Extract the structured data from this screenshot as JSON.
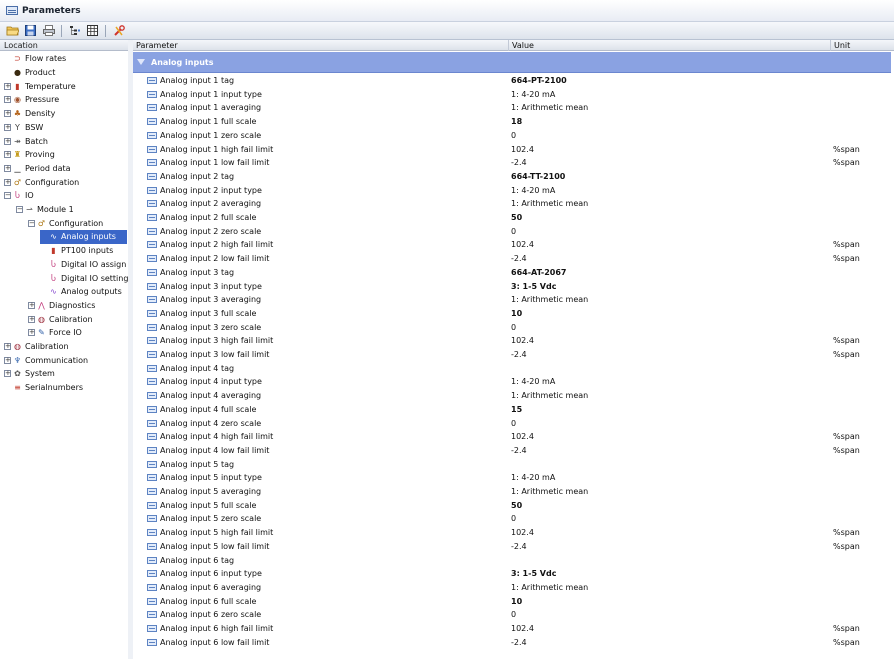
{
  "window": {
    "title": "Parameters"
  },
  "toolbar": {
    "icons": [
      "open-folder-icon",
      "save-icon",
      "print-icon",
      "tree-icon",
      "table-icon",
      "tools-icon"
    ]
  },
  "left_panel": {
    "header": "Location",
    "tree": [
      {
        "label": "Flow rates",
        "icon": "flow-icon",
        "depth": 0,
        "expander": "",
        "selected": false
      },
      {
        "label": "Product",
        "icon": "drop-icon",
        "depth": 0,
        "expander": "",
        "selected": false
      },
      {
        "label": "Temperature",
        "icon": "thermometer-icon",
        "depth": 0,
        "expander": "+",
        "selected": false
      },
      {
        "label": "Pressure",
        "icon": "gauge-icon",
        "depth": 0,
        "expander": "+",
        "selected": false
      },
      {
        "label": "Density",
        "icon": "density-icon",
        "depth": 0,
        "expander": "+",
        "selected": false
      },
      {
        "label": "BSW",
        "icon": "funnel-icon",
        "depth": 0,
        "expander": "+",
        "selected": false
      },
      {
        "label": "Batch",
        "icon": "batch-icon",
        "depth": 0,
        "expander": "+",
        "selected": false
      },
      {
        "label": "Proving",
        "icon": "proving-icon",
        "depth": 0,
        "expander": "+",
        "selected": false
      },
      {
        "label": "Period data",
        "icon": "period-icon",
        "depth": 0,
        "expander": "+",
        "selected": false
      },
      {
        "label": "Configuration",
        "icon": "configuration-icon",
        "depth": 0,
        "expander": "+",
        "selected": false
      },
      {
        "label": "IO",
        "icon": "io-icon",
        "depth": 0,
        "expander": "−",
        "selected": false
      },
      {
        "label": "Module 1",
        "icon": "module-icon",
        "depth": 1,
        "expander": "−",
        "selected": false
      },
      {
        "label": "Configuration",
        "icon": "configuration-icon",
        "depth": 2,
        "expander": "−",
        "selected": false
      },
      {
        "label": "Analog inputs",
        "icon": "analog-wave-icon",
        "depth": 3,
        "expander": "",
        "selected": true
      },
      {
        "label": "PT100 inputs",
        "icon": "thermometer-icon",
        "depth": 3,
        "expander": "",
        "selected": false
      },
      {
        "label": "Digital IO assign",
        "icon": "digital-icon",
        "depth": 3,
        "expander": "",
        "selected": false
      },
      {
        "label": "Digital IO settings",
        "icon": "digital-icon",
        "depth": 3,
        "expander": "",
        "selected": false
      },
      {
        "label": "Analog outputs",
        "icon": "analog-wave-icon",
        "depth": 3,
        "expander": "",
        "selected": false
      },
      {
        "label": "Diagnostics",
        "icon": "diagnostics-icon",
        "depth": 2,
        "expander": "+",
        "selected": false
      },
      {
        "label": "Calibration",
        "icon": "calibration-icon",
        "depth": 2,
        "expander": "+",
        "selected": false
      },
      {
        "label": "Force IO",
        "icon": "wrench-icon",
        "depth": 2,
        "expander": "+",
        "selected": false
      },
      {
        "label": "Calibration",
        "icon": "calibration-icon",
        "depth": 0,
        "expander": "+",
        "selected": false
      },
      {
        "label": "Communication",
        "icon": "network-icon",
        "depth": 0,
        "expander": "+",
        "selected": false
      },
      {
        "label": "System",
        "icon": "gear-icon",
        "depth": 0,
        "expander": "+",
        "selected": false
      },
      {
        "label": "Serialnumbers",
        "icon": "serial-icon",
        "depth": 0,
        "expander": "",
        "selected": false
      }
    ]
  },
  "grid": {
    "columns": {
      "parameter": "Parameter",
      "value": "Value",
      "unit": "Unit"
    },
    "group": "Analog inputs",
    "rows": [
      {
        "param": "Analog input 1 tag",
        "value": "664-PT-2100",
        "bold": true,
        "unit": ""
      },
      {
        "param": "Analog input 1 input type",
        "value": "1: 4-20 mA",
        "bold": false,
        "unit": ""
      },
      {
        "param": "Analog input 1 averaging",
        "value": "1: Arithmetic mean",
        "bold": false,
        "unit": ""
      },
      {
        "param": "Analog input 1 full scale",
        "value": "18",
        "bold": true,
        "unit": ""
      },
      {
        "param": "Analog input 1 zero scale",
        "value": "0",
        "bold": false,
        "unit": ""
      },
      {
        "param": "Analog input 1 high fail limit",
        "value": "102.4",
        "bold": false,
        "unit": "%span"
      },
      {
        "param": "Analog input 1 low fail limit",
        "value": "-2.4",
        "bold": false,
        "unit": "%span"
      },
      {
        "param": "Analog input 2 tag",
        "value": "664-TT-2100",
        "bold": true,
        "unit": ""
      },
      {
        "param": "Analog input 2 input type",
        "value": "1: 4-20 mA",
        "bold": false,
        "unit": ""
      },
      {
        "param": "Analog input 2 averaging",
        "value": "1: Arithmetic mean",
        "bold": false,
        "unit": ""
      },
      {
        "param": "Analog input 2 full scale",
        "value": "50",
        "bold": true,
        "unit": ""
      },
      {
        "param": "Analog input 2 zero scale",
        "value": "0",
        "bold": false,
        "unit": ""
      },
      {
        "param": "Analog input 2 high fail limit",
        "value": "102.4",
        "bold": false,
        "unit": "%span"
      },
      {
        "param": "Analog input 2 low fail limit",
        "value": "-2.4",
        "bold": false,
        "unit": "%span"
      },
      {
        "param": "Analog input 3 tag",
        "value": "664-AT-2067",
        "bold": true,
        "unit": ""
      },
      {
        "param": "Analog input 3 input type",
        "value": "3: 1-5 Vdc",
        "bold": true,
        "unit": ""
      },
      {
        "param": "Analog input 3 averaging",
        "value": "1: Arithmetic mean",
        "bold": false,
        "unit": ""
      },
      {
        "param": "Analog input 3 full scale",
        "value": "10",
        "bold": true,
        "unit": ""
      },
      {
        "param": "Analog input 3 zero scale",
        "value": "0",
        "bold": false,
        "unit": ""
      },
      {
        "param": "Analog input 3 high fail limit",
        "value": "102.4",
        "bold": false,
        "unit": "%span"
      },
      {
        "param": "Analog input 3 low fail limit",
        "value": "-2.4",
        "bold": false,
        "unit": "%span"
      },
      {
        "param": "Analog input 4 tag",
        "value": "",
        "bold": false,
        "unit": ""
      },
      {
        "param": "Analog input 4 input type",
        "value": "1: 4-20 mA",
        "bold": false,
        "unit": ""
      },
      {
        "param": "Analog input 4 averaging",
        "value": "1: Arithmetic mean",
        "bold": false,
        "unit": ""
      },
      {
        "param": "Analog input 4 full scale",
        "value": "15",
        "bold": true,
        "unit": ""
      },
      {
        "param": "Analog input 4 zero scale",
        "value": "0",
        "bold": false,
        "unit": ""
      },
      {
        "param": "Analog input 4 high fail limit",
        "value": "102.4",
        "bold": false,
        "unit": "%span"
      },
      {
        "param": "Analog input 4 low fail limit",
        "value": "-2.4",
        "bold": false,
        "unit": "%span"
      },
      {
        "param": "Analog input 5 tag",
        "value": "",
        "bold": false,
        "unit": ""
      },
      {
        "param": "Analog input 5 input type",
        "value": "1: 4-20 mA",
        "bold": false,
        "unit": ""
      },
      {
        "param": "Analog input 5 averaging",
        "value": "1: Arithmetic mean",
        "bold": false,
        "unit": ""
      },
      {
        "param": "Analog input 5 full scale",
        "value": "50",
        "bold": true,
        "unit": ""
      },
      {
        "param": "Analog input 5 zero scale",
        "value": "0",
        "bold": false,
        "unit": ""
      },
      {
        "param": "Analog input 5 high fail limit",
        "value": "102.4",
        "bold": false,
        "unit": "%span"
      },
      {
        "param": "Analog input 5 low fail limit",
        "value": "-2.4",
        "bold": false,
        "unit": "%span"
      },
      {
        "param": "Analog input 6 tag",
        "value": "",
        "bold": false,
        "unit": ""
      },
      {
        "param": "Analog input 6 input type",
        "value": "3: 1-5 Vdc",
        "bold": true,
        "unit": ""
      },
      {
        "param": "Analog input 6 averaging",
        "value": "1: Arithmetic mean",
        "bold": false,
        "unit": ""
      },
      {
        "param": "Analog input 6 full scale",
        "value": "10",
        "bold": true,
        "unit": ""
      },
      {
        "param": "Analog input 6 zero scale",
        "value": "0",
        "bold": false,
        "unit": ""
      },
      {
        "param": "Analog input 6 high fail limit",
        "value": "102.4",
        "bold": false,
        "unit": "%span"
      },
      {
        "param": "Analog input 6 low fail limit",
        "value": "-2.4",
        "bold": false,
        "unit": "%span"
      }
    ]
  }
}
